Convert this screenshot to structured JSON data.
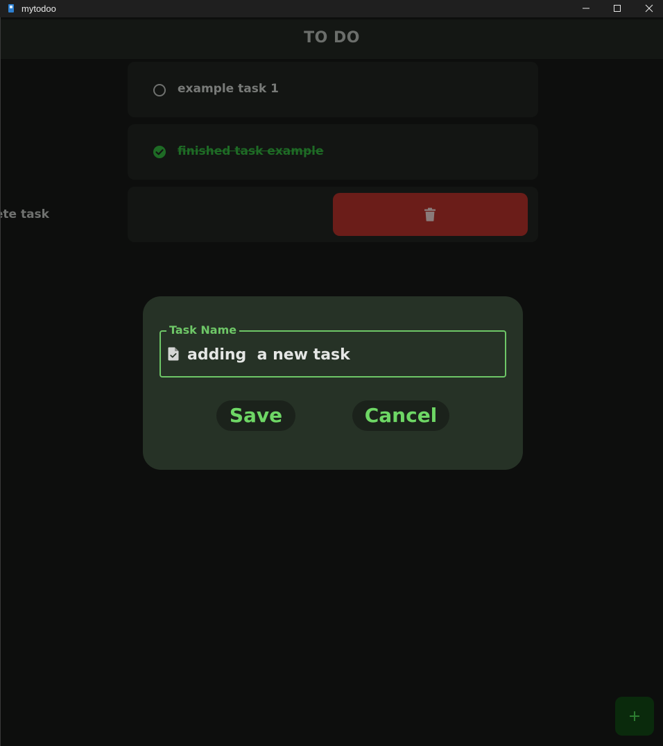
{
  "window": {
    "title": "mytodoo"
  },
  "header": {
    "title": "TO DO"
  },
  "tasks": [
    {
      "label": "example task 1",
      "completed": false
    },
    {
      "label": "finished task example",
      "completed": true
    }
  ],
  "swiped_task": {
    "visible_text": "ete task",
    "delete_icon": "trash-icon"
  },
  "dialog": {
    "field_label": "Task Name",
    "field_value": "adding  a new task",
    "field_icon": "task-file-icon",
    "save_label": "Save",
    "cancel_label": "Cancel"
  },
  "fab": {
    "icon": "plus-icon",
    "symbol": "+"
  },
  "colors": {
    "accent": "#6ec767",
    "dialog_bg": "#263226",
    "delete": "#6b1d19",
    "completed": "#1e6b25"
  }
}
